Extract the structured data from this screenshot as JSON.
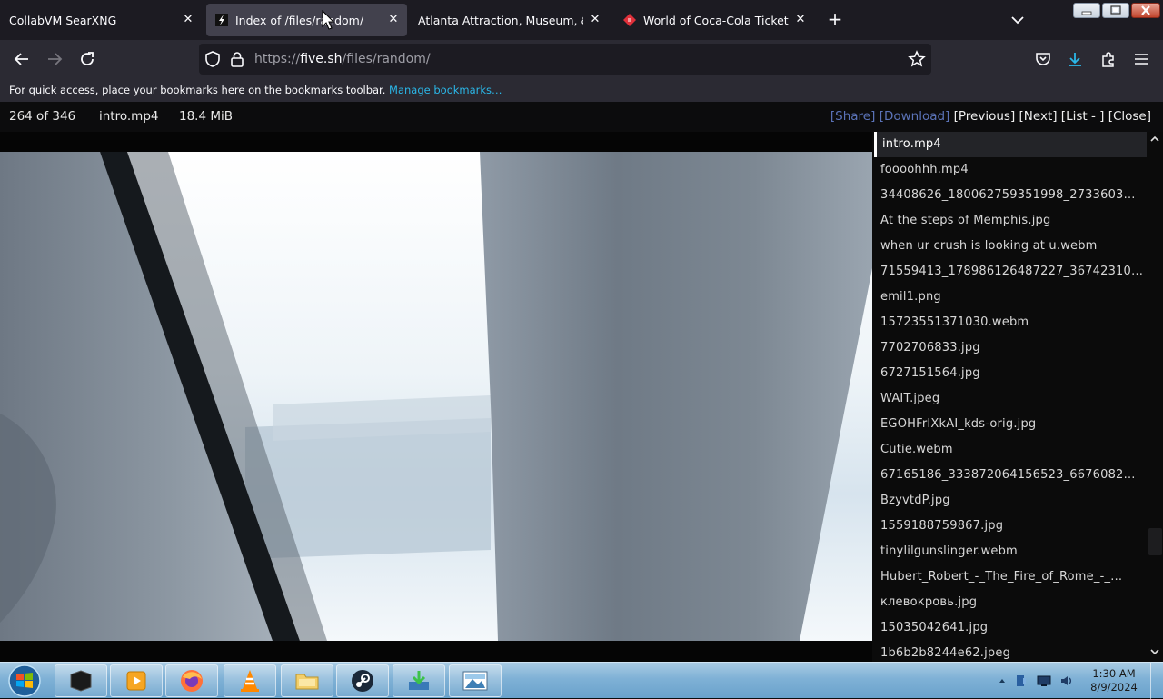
{
  "tabs": [
    {
      "title": "CollabVM SearXNG",
      "active": false
    },
    {
      "title": "Index of /files/random/",
      "active": true
    },
    {
      "title": "Atlanta Attraction, Museum, & Venue",
      "active": false
    },
    {
      "title": "World of Coca-Cola Ticketing S",
      "active": false
    }
  ],
  "url": {
    "prefix": "https://",
    "host": "five.sh",
    "path": "/files/random/"
  },
  "bookmarks": {
    "text": "For quick access, place your bookmarks here on the bookmarks toolbar.",
    "link": "Manage bookmarks…"
  },
  "viewer": {
    "counter": "264 of 346",
    "filename": "intro.mp4",
    "size": "18.4 MiB",
    "share": "[Share]",
    "download": "[Download]",
    "previous": "[Previous]",
    "next": "[Next]",
    "list": "[List - ]",
    "close": "[Close]"
  },
  "files": [
    "intro.mp4",
    "foooohhh.mp4",
    "34408626_180062759351998_2733603…",
    "At the steps of Memphis.jpg",
    "when ur crush is looking at u.webm",
    "71559413_178986126487227_36742310…",
    "emil1.png",
    "15723551371030.webm",
    "7702706833.jpg",
    "6727151564.jpg",
    "WAIT.jpeg",
    "EGOHFrIXkAI_kds-orig.jpg",
    "Cutie.webm",
    "67165186_333872064156523_6676082…",
    "BzyvtdP.jpg",
    "1559188759867.jpg",
    "tinylilgunslinger.webm",
    "Hubert_Robert_-_The_Fire_of_Rome_-_…",
    "клевокровь.jpg",
    "15035042641.jpg",
    "1b6b2b8244e62.jpeg"
  ],
  "clock": {
    "time": "1:30 AM",
    "date": "8/9/2024"
  },
  "colors": {
    "accent_link": "#2bb7e8",
    "active_tab": "#42414d",
    "viewer_link": "#5b73b8"
  }
}
